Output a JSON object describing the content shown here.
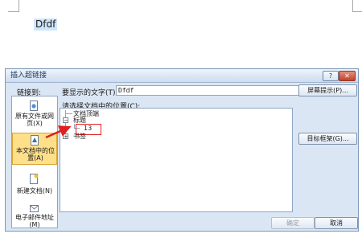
{
  "document": {
    "text": "Dfdf"
  },
  "dialog": {
    "title": "插入超链接",
    "help_label": "?",
    "close_label": "✕",
    "link_to_label": "链接到:",
    "display_text_label": "要显示的文字(T):",
    "display_text_value": "Dfdf",
    "screentip_label": "屏幕提示(P)...",
    "select_place_label": "请选择文档中的位置(C):",
    "target_frame_label": "目标框架(G)...",
    "ok_label": "确定",
    "cancel_label": "取消",
    "nav": {
      "existing_file": [
        "原有文件或网",
        "页(X)"
      ],
      "current_doc": [
        "本文档中的位",
        "置(A)"
      ],
      "new_doc": [
        "新建文档(N)"
      ],
      "email": [
        "电子邮件地址",
        "(M)"
      ]
    },
    "tree": {
      "top_of_document": "文档顶端",
      "headings": "标题",
      "heading_item": "13",
      "bookmarks": "书签",
      "expanded_symbol": "−",
      "collapsed_symbol": "+"
    }
  },
  "colors": {
    "annotation": "#e02020",
    "selection": "#ffe08a"
  }
}
